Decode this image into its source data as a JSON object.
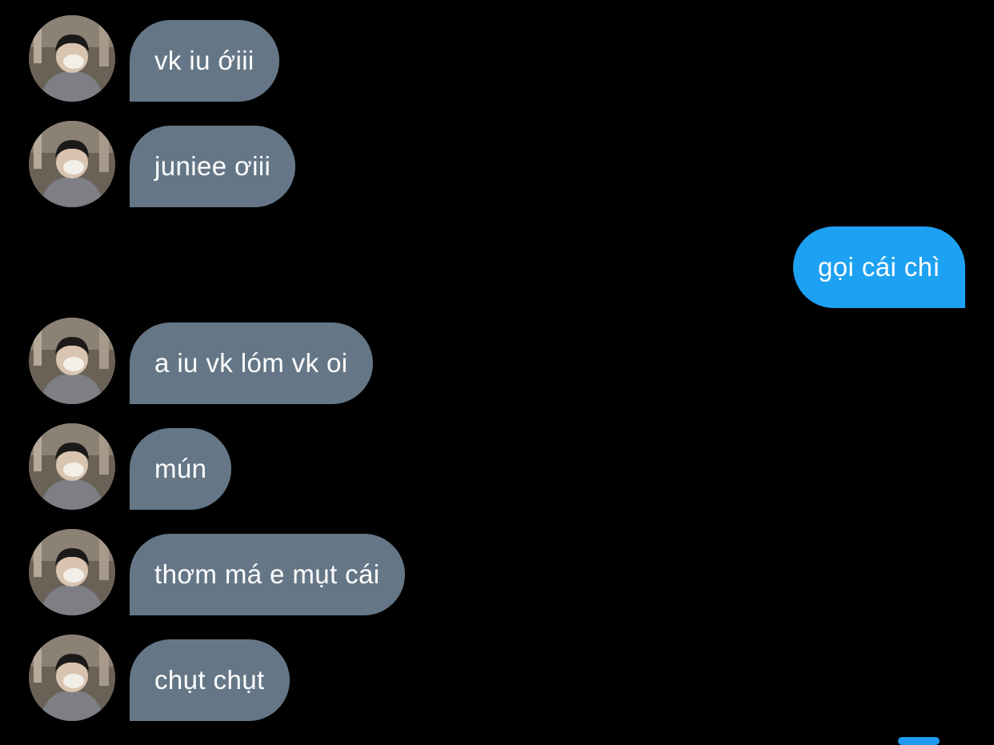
{
  "colors": {
    "background": "#000000",
    "incoming_bubble": "#657786",
    "outgoing_bubble": "#1da1f2",
    "text": "#ffffff"
  },
  "avatar_icon": "user-avatar-photo",
  "messages": [
    {
      "side": "incoming",
      "text": "vk iu ớiii"
    },
    {
      "side": "incoming",
      "text": "juniee ơiii"
    },
    {
      "side": "outgoing",
      "text": "gọi cái chì"
    },
    {
      "side": "incoming",
      "text": "a iu vk lóm vk oi"
    },
    {
      "side": "incoming",
      "text": "mún"
    },
    {
      "side": "incoming",
      "text": "thơm má e mụt cái"
    },
    {
      "side": "incoming",
      "text": "chụt chụt"
    }
  ]
}
